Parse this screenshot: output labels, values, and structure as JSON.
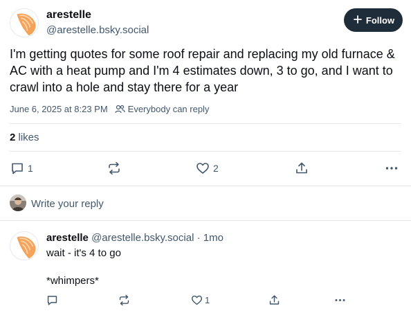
{
  "post": {
    "author_name": "arestelle",
    "author_handle": "@arestelle.bsky.social",
    "follow_label": "Follow",
    "text": "I'm getting quotes for some roof repair and replacing my old furnace & AC with a heat pump and I'm 4 estimates down, 3 to go, and I want to crawl into a hole and stay there for a year",
    "timestamp": "June 6, 2025 at 8:23 PM",
    "reply_setting": "Everybody can reply",
    "likes_count": "2",
    "likes_label": "likes",
    "actions": {
      "reply_count": "1",
      "repost_count": "",
      "like_count": "2"
    }
  },
  "composer": {
    "placeholder": "Write your reply"
  },
  "reply": {
    "author_name": "arestelle",
    "author_handle": "@arestelle.bsky.social",
    "separator": "·",
    "age": "1mo",
    "line1": "wait - it's 4 to go",
    "line2": "*whimpers*",
    "actions": {
      "like_count": "1"
    }
  },
  "colors": {
    "text_primary": "#0b0f14",
    "text_secondary": "#42576c",
    "follow_bg": "#1f2d3a",
    "divider": "#e4e8ec"
  },
  "icons": {
    "reply": "speech-bubble-icon",
    "repost": "repost-arrows-icon",
    "like": "heart-icon",
    "share": "share-icon",
    "more": "more-dots-icon",
    "follow": "plus-icon",
    "reply_setting": "people-icon"
  }
}
